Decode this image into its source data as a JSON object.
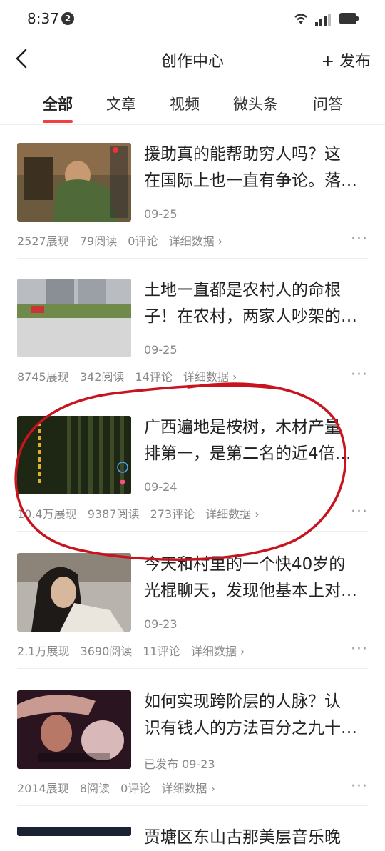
{
  "status_bar": {
    "time": "8:37",
    "notification_count": "2"
  },
  "header": {
    "title": "创作中心",
    "publish_label": "+ 发布"
  },
  "tabs": [
    {
      "label": "全部",
      "active": true
    },
    {
      "label": "文章",
      "active": false
    },
    {
      "label": "视频",
      "active": false
    },
    {
      "label": "微头条",
      "active": false
    },
    {
      "label": "问答",
      "active": false
    }
  ],
  "items": [
    {
      "title_line1": "援助真的能帮助穷人吗？这",
      "title_line2": "在国际上也一直有争论。落…",
      "date": "09-25",
      "impressions": "2527展现",
      "reads": "79阅读",
      "comments": "0评论",
      "detail": "详细数据 ›"
    },
    {
      "title_line1": "土地一直都是农村人的命根",
      "title_line2": "子！在农村，两家人吵架的…",
      "date": "09-25",
      "impressions": "8745展现",
      "reads": "342阅读",
      "comments": "14评论",
      "detail": "详细数据 ›"
    },
    {
      "title_line1": "广西遍地是桉树，木材产量",
      "title_line2": "排第一，是第二名的近4倍…",
      "date": "09-24",
      "impressions": "10.4万展现",
      "reads": "9387阅读",
      "comments": "273评论",
      "detail": "详细数据 ›"
    },
    {
      "title_line1": "今天和村里的一个快40岁的",
      "title_line2": "光棍聊天，发现他基本上对…",
      "date": "09-23",
      "impressions": "2.1万展现",
      "reads": "3690阅读",
      "comments": "11评论",
      "detail": "详细数据 ›"
    },
    {
      "title_line1": "如何实现跨阶层的人脉？认",
      "title_line2": "识有钱人的方法百分之九十…",
      "date": "已发布  09-23",
      "impressions": "2014展现",
      "reads": "8阅读",
      "comments": "0评论",
      "detail": "详细数据 ›"
    },
    {
      "title_line1": "贾塘区东山古那美层音乐晚",
      "title_line2": "",
      "date": "",
      "impressions": "",
      "reads": "",
      "comments": "",
      "detail": ""
    }
  ],
  "more_icon": "more-dots-icon",
  "colors": {
    "accent": "#f04142",
    "annotation_circle": "#c8141e"
  }
}
